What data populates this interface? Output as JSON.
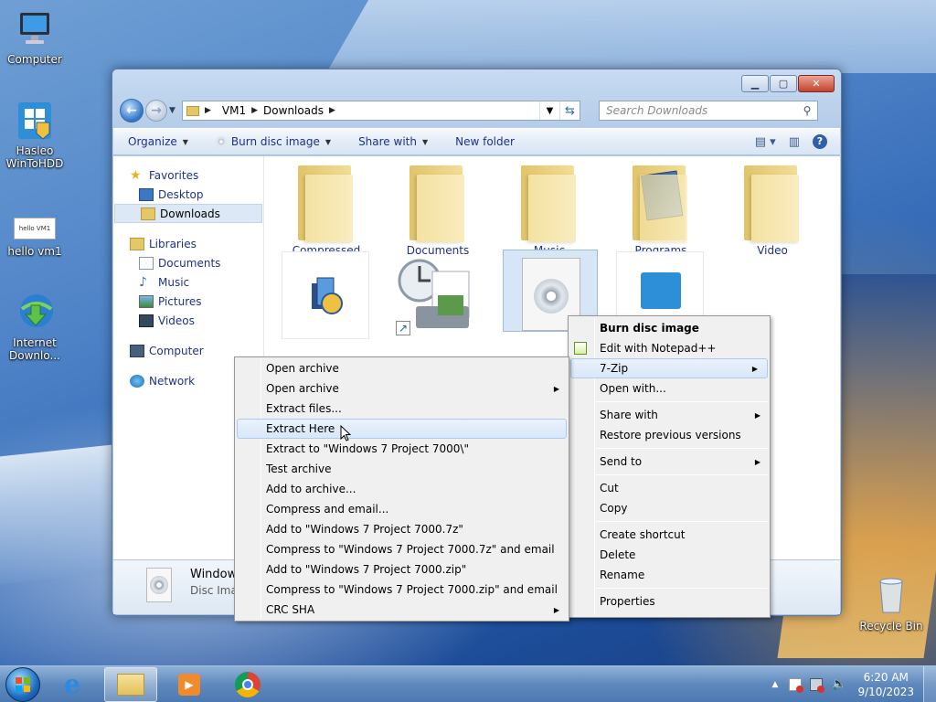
{
  "desktop": {
    "icons": [
      {
        "label": "Computer",
        "icon": "computer-icon"
      },
      {
        "label": "Hasleo WinToHDD",
        "icon": "wintohdd-icon"
      },
      {
        "label": "hello vm1",
        "icon": "text-file-icon",
        "thumb": "hello VM1"
      },
      {
        "label": "Internet Downlo...",
        "icon": "internet-download-manager-icon"
      },
      {
        "label": "Recycle Bin",
        "icon": "recycle-bin-icon"
      }
    ]
  },
  "window": {
    "nav": {
      "path": [
        "VM1",
        "Downloads"
      ],
      "search_placeholder": "Search Downloads"
    },
    "toolbar": {
      "organize": "Organize",
      "burn": "Burn disc image",
      "share": "Share with",
      "new_folder": "New folder"
    },
    "nav_pane": {
      "favorites": "Favorites",
      "desktop": "Desktop",
      "downloads": "Downloads",
      "libraries": "Libraries",
      "documents": "Documents",
      "music": "Music",
      "pictures": "Pictures",
      "videos": "Videos",
      "computer": "Computer",
      "network": "Network"
    },
    "folders": [
      "Compressed",
      "Documents",
      "Music",
      "Programs",
      "Video"
    ],
    "details": {
      "name": "Window",
      "type": "Disc Imag"
    }
  },
  "context_menu": {
    "items": [
      "Burn disc image",
      "Edit with Notepad++",
      "7-Zip",
      "Open with...",
      "Share with",
      "Restore previous versions",
      "Send to",
      "Cut",
      "Copy",
      "Create shortcut",
      "Delete",
      "Rename",
      "Properties"
    ]
  },
  "zip_menu": {
    "items": [
      "Open archive",
      "Open archive",
      "Extract files...",
      "Extract Here",
      "Extract to \"Windows 7 Project 7000\\\"",
      "Test archive",
      "Add to archive...",
      "Compress and email...",
      "Add to \"Windows 7 Project 7000.7z\"",
      "Compress to \"Windows 7 Project 7000.7z\" and email",
      "Add to \"Windows 7 Project 7000.zip\"",
      "Compress to \"Windows 7 Project 7000.zip\" and email",
      "CRC SHA"
    ]
  },
  "taskbar": {
    "time": "6:20 AM",
    "date": "9/10/2023"
  },
  "colors": {
    "link": "#1e3287",
    "menu_bg": "#f0f0f0",
    "highlight": "#d9e7f8"
  }
}
